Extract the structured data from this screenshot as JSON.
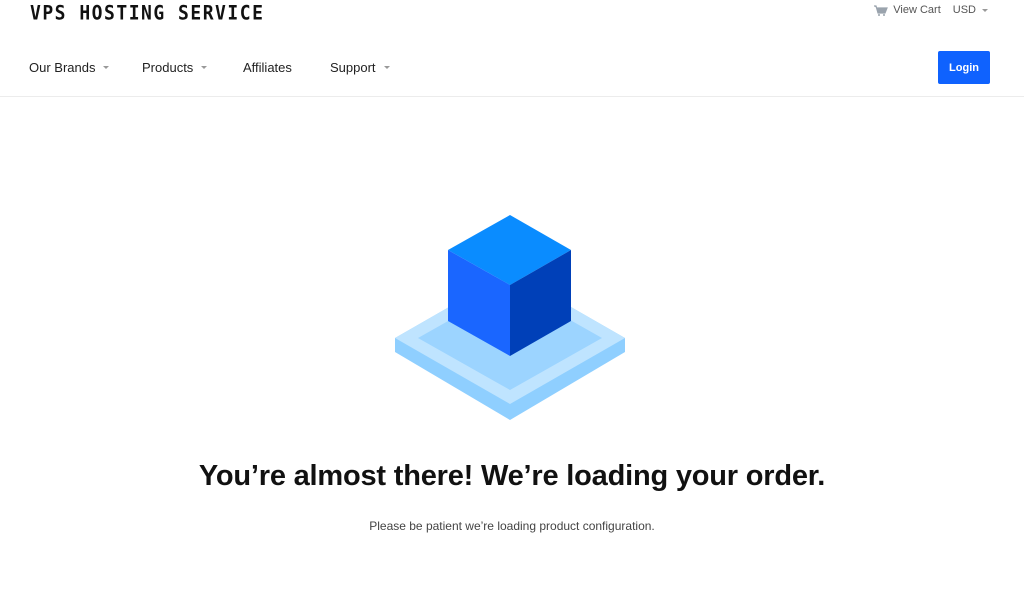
{
  "brand": {
    "logo_text": "VPS HOSTING SERVICE"
  },
  "topbar": {
    "cart_label": "View Cart",
    "currency": "USD"
  },
  "nav": {
    "items": [
      {
        "label": "Our Brands"
      },
      {
        "label": "Products"
      },
      {
        "label": "Affiliates"
      },
      {
        "label": "Support"
      }
    ],
    "login_label": "Login"
  },
  "main": {
    "headline": "You’re almost there! We’re loading your order.",
    "subtext": "Please be patient we’re loading product configuration."
  },
  "colors": {
    "accent": "#0f62fe",
    "cube_top": "#0a8cff",
    "cube_left": "#1a66ff",
    "cube_right": "#0040b8",
    "platform": "#a9dbff"
  }
}
